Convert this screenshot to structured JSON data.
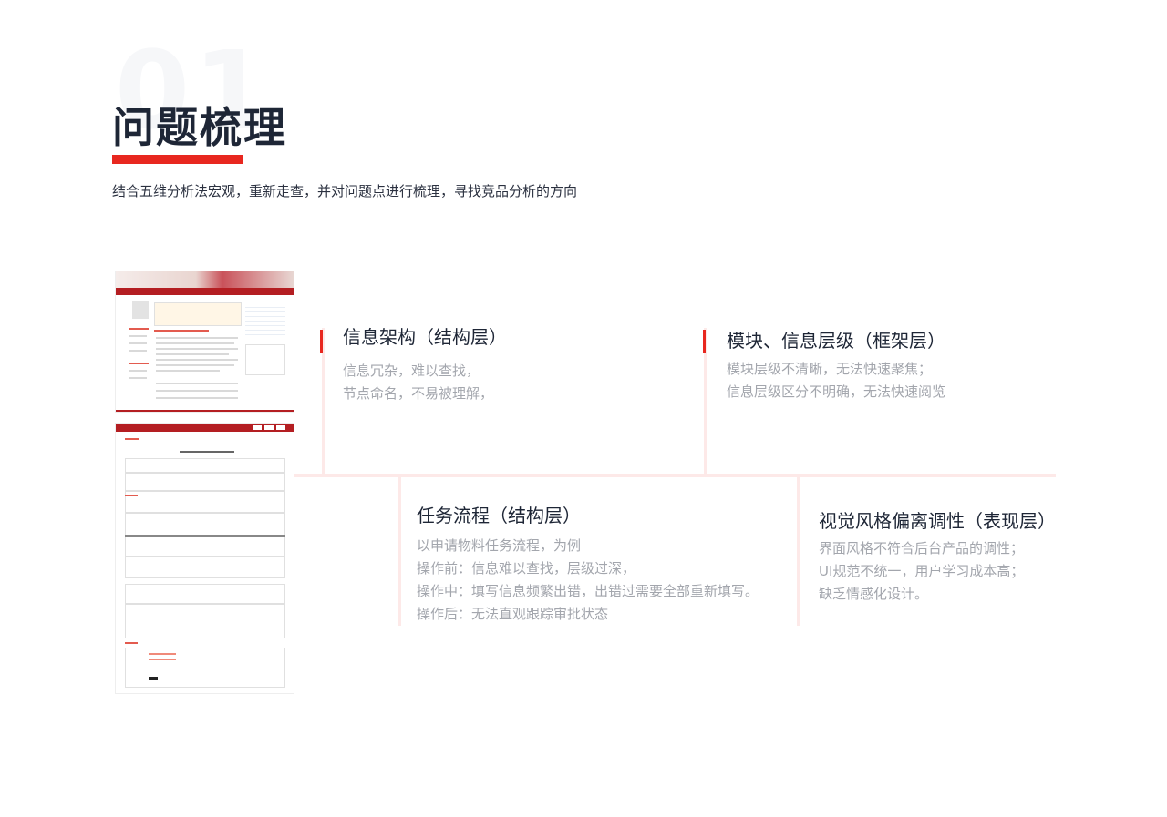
{
  "header": {
    "background_number": "01",
    "title": "问题梳理",
    "subtitle": "结合五维分析法宏观，重新走查，并对问题点进行梳理，寻找竞品分析的方向"
  },
  "cards": [
    {
      "title": "信息架构（结构层）",
      "lines": [
        "信息冗杂，难以查找，",
        "节点命名，不易被理解，"
      ]
    },
    {
      "title": "模块、信息层级（框架层）",
      "lines": [
        "模块层级不清晰，无法快速聚焦；",
        "信息层级区分不明确，无法快速阅览"
      ]
    },
    {
      "title": "任务流程（结构层）",
      "lines": [
        "以申请物料任务流程，为例",
        "操作前：信息难以查找，层级过深，",
        "操作中：填写信息频繁出错，出错过需要全部重新填写。",
        "操作后：无法直观跟踪审批状态"
      ]
    },
    {
      "title": "视觉风格偏离调性（表现层）",
      "lines": [
        "界面风格不符合后台产品的调性；",
        "UI规范不统一，用户学习成本高；",
        "缺乏情感化设计。"
      ]
    }
  ],
  "colors": {
    "accent": "#e8271f",
    "line": "#fde9e8",
    "title": "#1e2636",
    "muted": "#a3a6ad"
  }
}
